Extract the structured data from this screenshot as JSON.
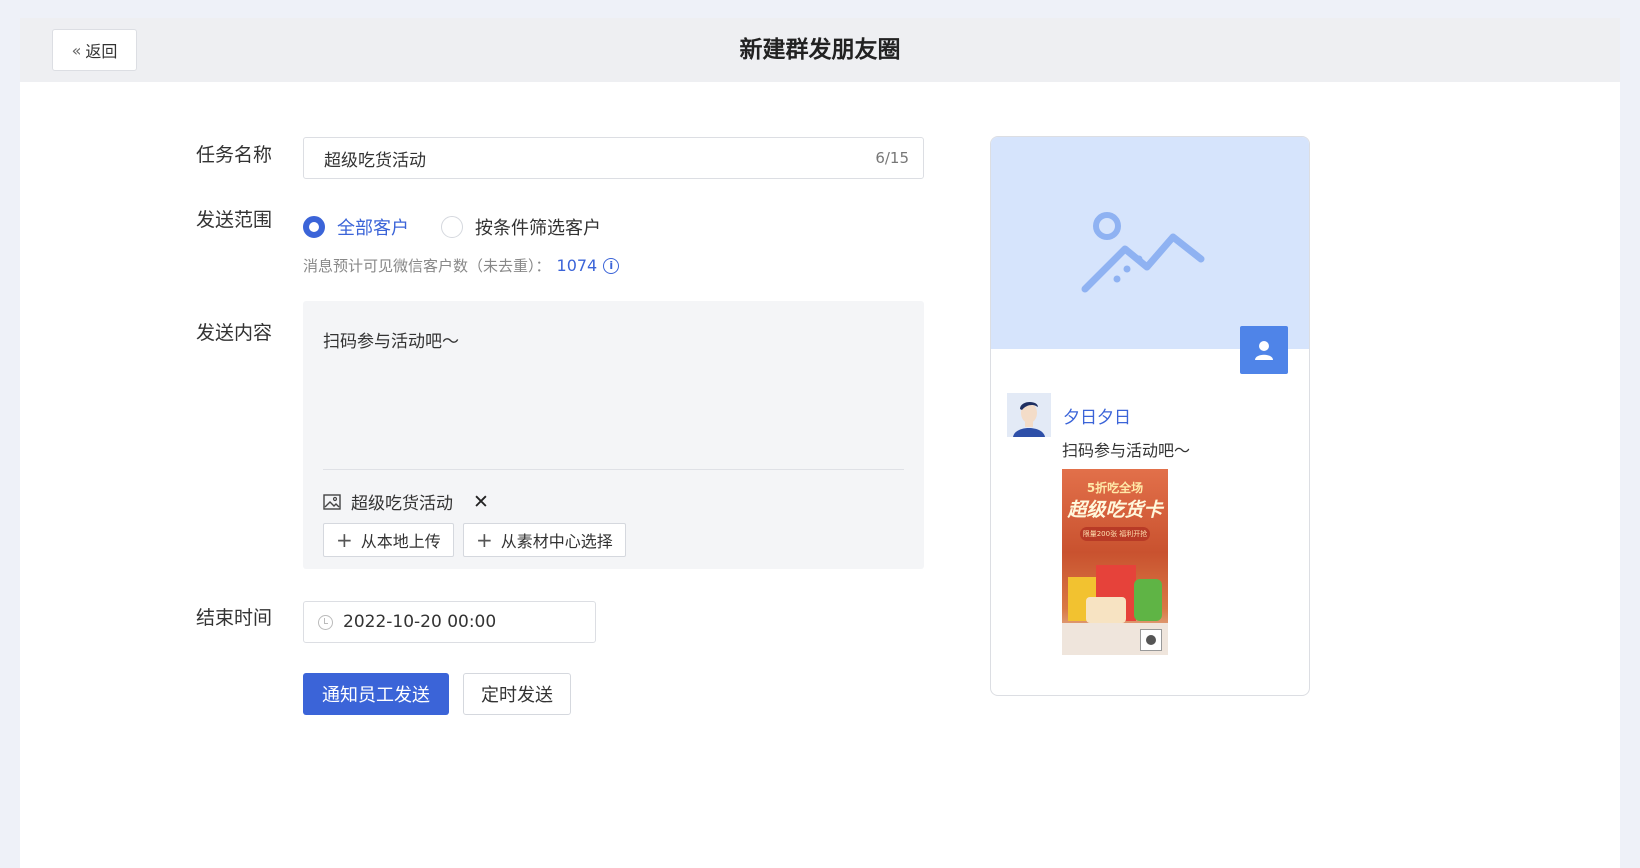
{
  "header": {
    "back_label": "返回",
    "title": "新建群发朋友圈"
  },
  "form": {
    "task_name": {
      "label": "任务名称",
      "value": "超级吃货活动",
      "count": "6/15"
    },
    "scope": {
      "label": "发送范围",
      "options": [
        {
          "label": "全部客户",
          "selected": true
        },
        {
          "label": "按条件筛选客户",
          "selected": false
        }
      ],
      "hint_text": "消息预计可见微信客户数（未去重）：",
      "hint_count": "1074"
    },
    "content": {
      "label": "发送内容",
      "text": "扫码参与活动吧～",
      "attachment_name": "超级吃货活动",
      "upload_local_label": "从本地上传",
      "choose_material_label": "从素材中心选择"
    },
    "end_time": {
      "label": "结束时间",
      "value": "2022-10-20 00:00"
    },
    "actions": {
      "notify_label": "通知员工发送",
      "schedule_label": "定时发送"
    }
  },
  "preview": {
    "nickname": "夕日夕日",
    "post_text": "扫码参与活动吧～",
    "poster_line1": "5折吃全场",
    "poster_line2": "超级吃货卡",
    "poster_line3": "限量200张 福利开抢"
  },
  "colors": {
    "accent": "#3b64d8",
    "cover_bg": "#d6e4fc",
    "page_bg": "#eef1f8"
  }
}
